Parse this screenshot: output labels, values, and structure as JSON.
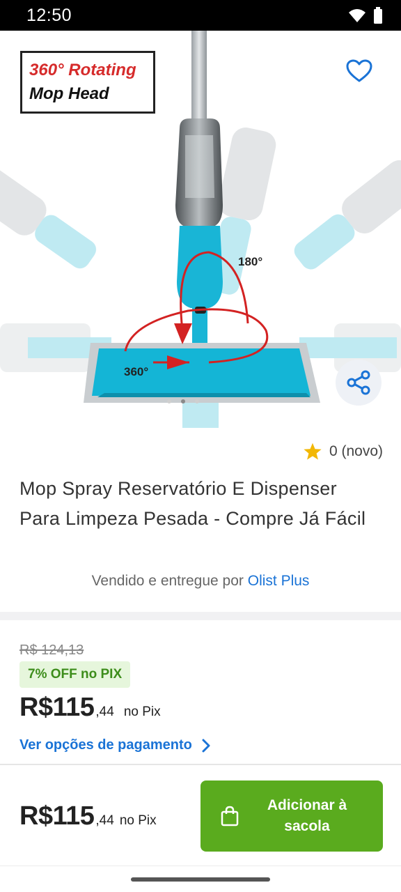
{
  "status_bar": {
    "time": "12:50"
  },
  "product_image": {
    "badge_line1": "360° Rotating",
    "badge_line2": "Mop Head",
    "label_180": "180°",
    "label_360": "360°",
    "carousel_total": 3,
    "carousel_active": 2
  },
  "rating": {
    "star_icon": "star-icon",
    "text": "0 (novo)"
  },
  "product": {
    "title": "Mop Spray Reservatório E Dispenser Para Limpeza Pesada - Compre Já Fácil",
    "seller_prefix": "Vendido e entregue por ",
    "seller_name": "Olist Plus"
  },
  "pricing": {
    "old_price": "R$ 124,13",
    "discount_badge": "7% OFF no PIX",
    "price_main": "R$115",
    "price_cents": ",44",
    "price_suffix": "no Pix",
    "payment_options_link": "Ver opções de pagamento"
  },
  "bottom_bar": {
    "price_main": "R$115",
    "price_cents": ",44",
    "price_suffix": "no Pix",
    "add_to_bag_label": "Adicionar à sacola"
  },
  "colors": {
    "accent_blue": "#1a73d6",
    "buy_green": "#5aab1e",
    "discount_green": "#3d8d1b",
    "star_yellow": "#f2b705"
  }
}
